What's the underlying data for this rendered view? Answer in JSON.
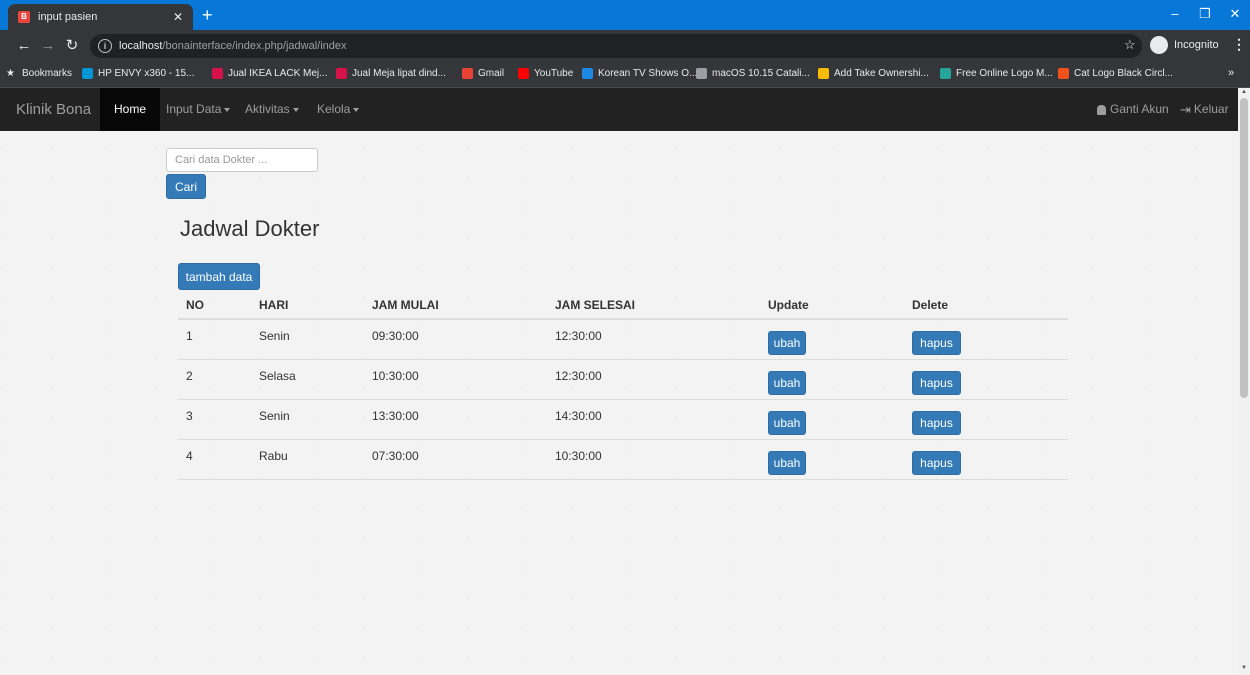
{
  "browser": {
    "tab_title": "input pasien",
    "tab_icon": "page-favicon",
    "url_host": "localhost",
    "url_path": "/bonainterface/index.php/jadwal/index",
    "incognito_label": "Incognito",
    "bookmarks": [
      {
        "label": "Bookmarks",
        "color": "#e8eaed"
      },
      {
        "label": "HP ENVY x360 - 15...",
        "color": "#0096d6"
      },
      {
        "label": "Jual IKEA LACK Mej...",
        "color": "#d71149"
      },
      {
        "label": "Jual Meja lipat dind...",
        "color": "#d71149"
      },
      {
        "label": "Gmail",
        "color": "#ea4335"
      },
      {
        "label": "YouTube",
        "color": "#ff0000"
      },
      {
        "label": "Korean TV Shows O...",
        "color": "#1e88e5"
      },
      {
        "label": "macOS 10.15 Catali...",
        "color": "#9aa0a6"
      },
      {
        "label": "Add Take Ownershi...",
        "color": "#fbbc05"
      },
      {
        "label": "Free Online Logo M...",
        "color": "#26a69a"
      },
      {
        "label": "Cat Logo Black Circl...",
        "color": "#f4511e"
      }
    ]
  },
  "navbar": {
    "brand": "Klinik Bona",
    "items": [
      {
        "label": "Home",
        "active": true
      },
      {
        "label": "Input Data",
        "dropdown": true
      },
      {
        "label": "Aktivitas",
        "dropdown": true
      },
      {
        "label": "Kelola",
        "dropdown": true
      }
    ],
    "right": {
      "account": "Ganti Akun",
      "logout": "Keluar"
    }
  },
  "search": {
    "placeholder": "Cari data Dokter ...",
    "button": "Cari"
  },
  "page": {
    "title": "Jadwal Dokter",
    "add_button": "tambah data"
  },
  "table": {
    "headers": [
      "NO",
      "HARI",
      "JAM MULAI",
      "JAM SELESAI",
      "Update",
      "Delete"
    ],
    "rows": [
      {
        "no": "1",
        "hari": "Senin",
        "mulai": "09:30:00",
        "selesai": "12:30:00",
        "update": "ubah",
        "delete": "hapus"
      },
      {
        "no": "2",
        "hari": "Selasa",
        "mulai": "10:30:00",
        "selesai": "12:30:00",
        "update": "ubah",
        "delete": "hapus"
      },
      {
        "no": "3",
        "hari": "Senin",
        "mulai": "13:30:00",
        "selesai": "14:30:00",
        "update": "ubah",
        "delete": "hapus"
      },
      {
        "no": "4",
        "hari": "Rabu",
        "mulai": "07:30:00",
        "selesai": "10:30:00",
        "update": "ubah",
        "delete": "hapus"
      }
    ]
  },
  "colors": {
    "primary": "#337ab7",
    "navbar_bg": "#222222",
    "chrome_titlebar": "#0878d8"
  }
}
